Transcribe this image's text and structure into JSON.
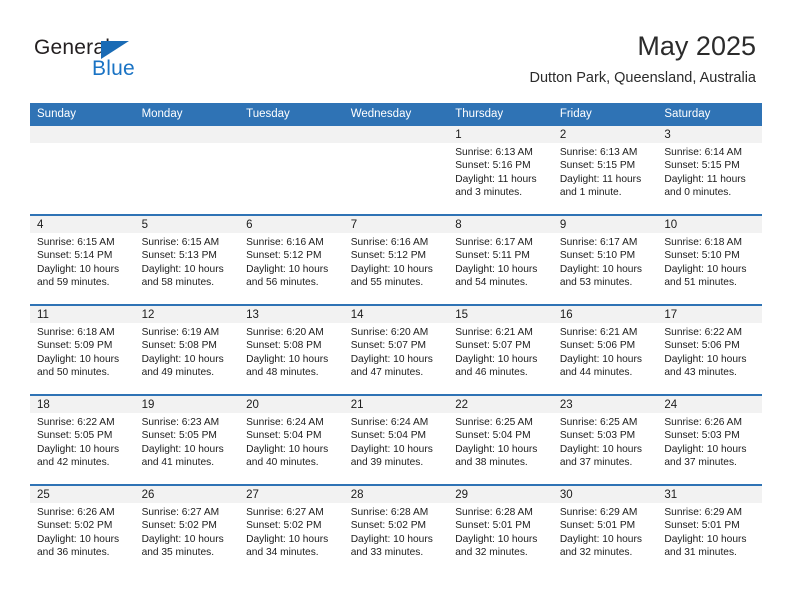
{
  "brand": {
    "name_top": "General",
    "name_bottom": "Blue",
    "accent_color": "#1a73c4",
    "triangle_color": "#1a6bb5"
  },
  "header": {
    "month_title": "May 2025",
    "location": "Dutton Park, Queensland, Australia"
  },
  "theme": {
    "header_blue": "#2f73b5",
    "daynum_band": "#f2f2f2",
    "text": "#1c1c1c"
  },
  "calendar": {
    "weekday_headers": [
      "Sunday",
      "Monday",
      "Tuesday",
      "Wednesday",
      "Thursday",
      "Friday",
      "Saturday"
    ],
    "labels": {
      "sunrise": "Sunrise:",
      "sunset": "Sunset:",
      "daylight": "Daylight:"
    },
    "weeks": [
      [
        {
          "day": "",
          "empty": true
        },
        {
          "day": "",
          "empty": true
        },
        {
          "day": "",
          "empty": true
        },
        {
          "day": "",
          "empty": true
        },
        {
          "day": "1",
          "sunrise": "Sunrise: 6:13 AM",
          "sunset": "Sunset: 5:16 PM",
          "daylight": "Daylight: 11 hours and 3 minutes."
        },
        {
          "day": "2",
          "sunrise": "Sunrise: 6:13 AM",
          "sunset": "Sunset: 5:15 PM",
          "daylight": "Daylight: 11 hours and 1 minute."
        },
        {
          "day": "3",
          "sunrise": "Sunrise: 6:14 AM",
          "sunset": "Sunset: 5:15 PM",
          "daylight": "Daylight: 11 hours and 0 minutes."
        }
      ],
      [
        {
          "day": "4",
          "sunrise": "Sunrise: 6:15 AM",
          "sunset": "Sunset: 5:14 PM",
          "daylight": "Daylight: 10 hours and 59 minutes."
        },
        {
          "day": "5",
          "sunrise": "Sunrise: 6:15 AM",
          "sunset": "Sunset: 5:13 PM",
          "daylight": "Daylight: 10 hours and 58 minutes."
        },
        {
          "day": "6",
          "sunrise": "Sunrise: 6:16 AM",
          "sunset": "Sunset: 5:12 PM",
          "daylight": "Daylight: 10 hours and 56 minutes."
        },
        {
          "day": "7",
          "sunrise": "Sunrise: 6:16 AM",
          "sunset": "Sunset: 5:12 PM",
          "daylight": "Daylight: 10 hours and 55 minutes."
        },
        {
          "day": "8",
          "sunrise": "Sunrise: 6:17 AM",
          "sunset": "Sunset: 5:11 PM",
          "daylight": "Daylight: 10 hours and 54 minutes."
        },
        {
          "day": "9",
          "sunrise": "Sunrise: 6:17 AM",
          "sunset": "Sunset: 5:10 PM",
          "daylight": "Daylight: 10 hours and 53 minutes."
        },
        {
          "day": "10",
          "sunrise": "Sunrise: 6:18 AM",
          "sunset": "Sunset: 5:10 PM",
          "daylight": "Daylight: 10 hours and 51 minutes."
        }
      ],
      [
        {
          "day": "11",
          "sunrise": "Sunrise: 6:18 AM",
          "sunset": "Sunset: 5:09 PM",
          "daylight": "Daylight: 10 hours and 50 minutes."
        },
        {
          "day": "12",
          "sunrise": "Sunrise: 6:19 AM",
          "sunset": "Sunset: 5:08 PM",
          "daylight": "Daylight: 10 hours and 49 minutes."
        },
        {
          "day": "13",
          "sunrise": "Sunrise: 6:20 AM",
          "sunset": "Sunset: 5:08 PM",
          "daylight": "Daylight: 10 hours and 48 minutes."
        },
        {
          "day": "14",
          "sunrise": "Sunrise: 6:20 AM",
          "sunset": "Sunset: 5:07 PM",
          "daylight": "Daylight: 10 hours and 47 minutes."
        },
        {
          "day": "15",
          "sunrise": "Sunrise: 6:21 AM",
          "sunset": "Sunset: 5:07 PM",
          "daylight": "Daylight: 10 hours and 46 minutes."
        },
        {
          "day": "16",
          "sunrise": "Sunrise: 6:21 AM",
          "sunset": "Sunset: 5:06 PM",
          "daylight": "Daylight: 10 hours and 44 minutes."
        },
        {
          "day": "17",
          "sunrise": "Sunrise: 6:22 AM",
          "sunset": "Sunset: 5:06 PM",
          "daylight": "Daylight: 10 hours and 43 minutes."
        }
      ],
      [
        {
          "day": "18",
          "sunrise": "Sunrise: 6:22 AM",
          "sunset": "Sunset: 5:05 PM",
          "daylight": "Daylight: 10 hours and 42 minutes."
        },
        {
          "day": "19",
          "sunrise": "Sunrise: 6:23 AM",
          "sunset": "Sunset: 5:05 PM",
          "daylight": "Daylight: 10 hours and 41 minutes."
        },
        {
          "day": "20",
          "sunrise": "Sunrise: 6:24 AM",
          "sunset": "Sunset: 5:04 PM",
          "daylight": "Daylight: 10 hours and 40 minutes."
        },
        {
          "day": "21",
          "sunrise": "Sunrise: 6:24 AM",
          "sunset": "Sunset: 5:04 PM",
          "daylight": "Daylight: 10 hours and 39 minutes."
        },
        {
          "day": "22",
          "sunrise": "Sunrise: 6:25 AM",
          "sunset": "Sunset: 5:04 PM",
          "daylight": "Daylight: 10 hours and 38 minutes."
        },
        {
          "day": "23",
          "sunrise": "Sunrise: 6:25 AM",
          "sunset": "Sunset: 5:03 PM",
          "daylight": "Daylight: 10 hours and 37 minutes."
        },
        {
          "day": "24",
          "sunrise": "Sunrise: 6:26 AM",
          "sunset": "Sunset: 5:03 PM",
          "daylight": "Daylight: 10 hours and 37 minutes."
        }
      ],
      [
        {
          "day": "25",
          "sunrise": "Sunrise: 6:26 AM",
          "sunset": "Sunset: 5:02 PM",
          "daylight": "Daylight: 10 hours and 36 minutes."
        },
        {
          "day": "26",
          "sunrise": "Sunrise: 6:27 AM",
          "sunset": "Sunset: 5:02 PM",
          "daylight": "Daylight: 10 hours and 35 minutes."
        },
        {
          "day": "27",
          "sunrise": "Sunrise: 6:27 AM",
          "sunset": "Sunset: 5:02 PM",
          "daylight": "Daylight: 10 hours and 34 minutes."
        },
        {
          "day": "28",
          "sunrise": "Sunrise: 6:28 AM",
          "sunset": "Sunset: 5:02 PM",
          "daylight": "Daylight: 10 hours and 33 minutes."
        },
        {
          "day": "29",
          "sunrise": "Sunrise: 6:28 AM",
          "sunset": "Sunset: 5:01 PM",
          "daylight": "Daylight: 10 hours and 32 minutes."
        },
        {
          "day": "30",
          "sunrise": "Sunrise: 6:29 AM",
          "sunset": "Sunset: 5:01 PM",
          "daylight": "Daylight: 10 hours and 32 minutes."
        },
        {
          "day": "31",
          "sunrise": "Sunrise: 6:29 AM",
          "sunset": "Sunset: 5:01 PM",
          "daylight": "Daylight: 10 hours and 31 minutes."
        }
      ]
    ]
  }
}
